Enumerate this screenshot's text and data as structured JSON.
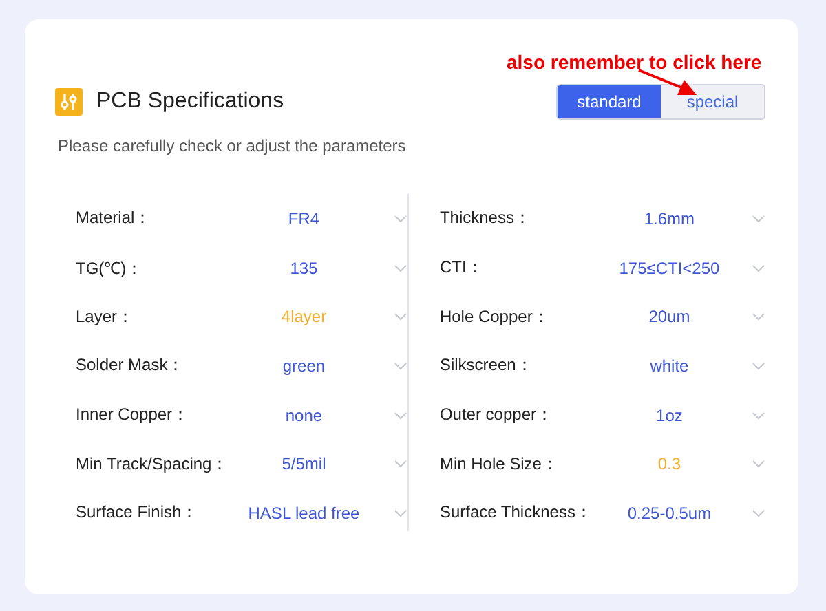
{
  "header": {
    "title": "PCB Specifications",
    "subtitle": "Please carefully check or adjust the parameters"
  },
  "modes": [
    {
      "label": "standard",
      "selected": true
    },
    {
      "label": "special",
      "selected": false
    }
  ],
  "annotation": {
    "text": "also remember to click here"
  },
  "columns": [
    [
      {
        "label": "Material：",
        "value": "FR4",
        "highlighted": false
      },
      {
        "label": "TG(℃)：",
        "value": "135",
        "highlighted": false
      },
      {
        "label": "Layer：",
        "value": "4layer",
        "highlighted": true
      },
      {
        "label": "Solder Mask：",
        "value": "green",
        "highlighted": false
      },
      {
        "label": "Inner Copper：",
        "value": "none",
        "highlighted": false
      },
      {
        "label": "Min Track/Spacing：",
        "value": "5/5mil",
        "highlighted": false
      },
      {
        "label": "Surface Finish：",
        "value": "HASL lead free",
        "highlighted": false
      }
    ],
    [
      {
        "label": "Thickness：",
        "value": "1.6mm",
        "highlighted": false
      },
      {
        "label": "CTI：",
        "value": "175≤CTI<250",
        "highlighted": false
      },
      {
        "label": "Hole Copper：",
        "value": "20um",
        "highlighted": false
      },
      {
        "label": "Silkscreen：",
        "value": "white",
        "highlighted": false
      },
      {
        "label": "Outer copper：",
        "value": "1oz",
        "highlighted": false
      },
      {
        "label": "Min Hole Size：",
        "value": "0.3",
        "highlighted": true
      },
      {
        "label": "Surface Thickness：",
        "value": "0.25-0.5um",
        "highlighted": false
      }
    ]
  ]
}
